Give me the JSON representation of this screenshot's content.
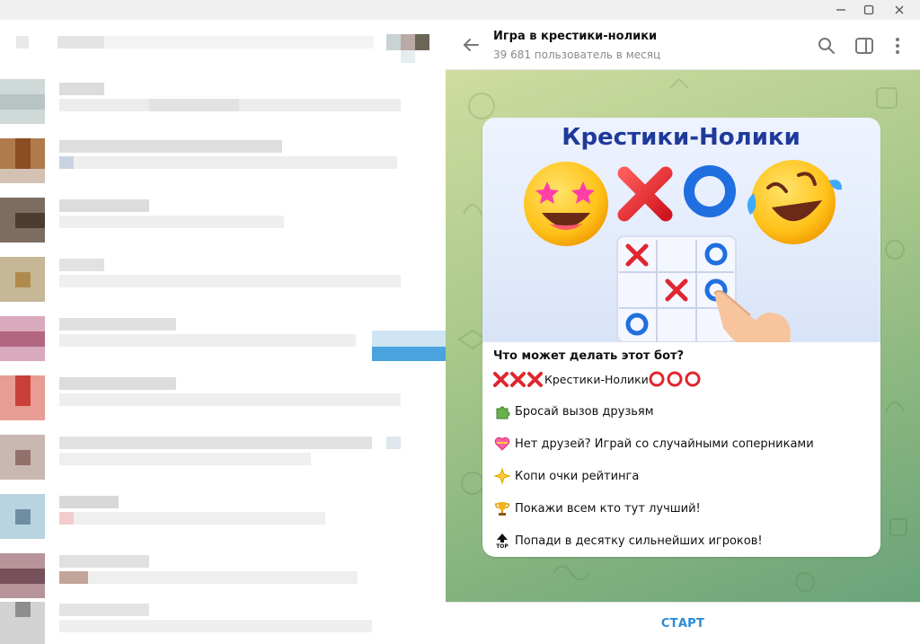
{
  "header": {
    "title": "Игра в крестики-нолики",
    "subtitle": "39 681 пользователь в месяц"
  },
  "banner": {
    "title": "Крестики-Нолики"
  },
  "description": {
    "heading": "Что может делать этот бот?",
    "game_line": "Крестики-Нолики",
    "features": [
      {
        "icon": "puzzle-icon",
        "text": "Бросай вызов друзьям"
      },
      {
        "icon": "heart-icon",
        "text": "Нет друзей? Играй со случайными соперниками"
      },
      {
        "icon": "sparkle-star-icon",
        "text": "Копи очки рейтинга"
      },
      {
        "icon": "trophy-icon",
        "text": "Покажи всем кто тут лучший!"
      },
      {
        "icon": "top-arrow-icon",
        "text": "Попади в десятку сильнейших игроков!"
      }
    ]
  },
  "footer": {
    "start_label": "СТАРТ"
  },
  "colors": {
    "accent": "#2a8bd8",
    "cross_red": "#e0262f",
    "circle_blue": "#1f6fe0"
  }
}
